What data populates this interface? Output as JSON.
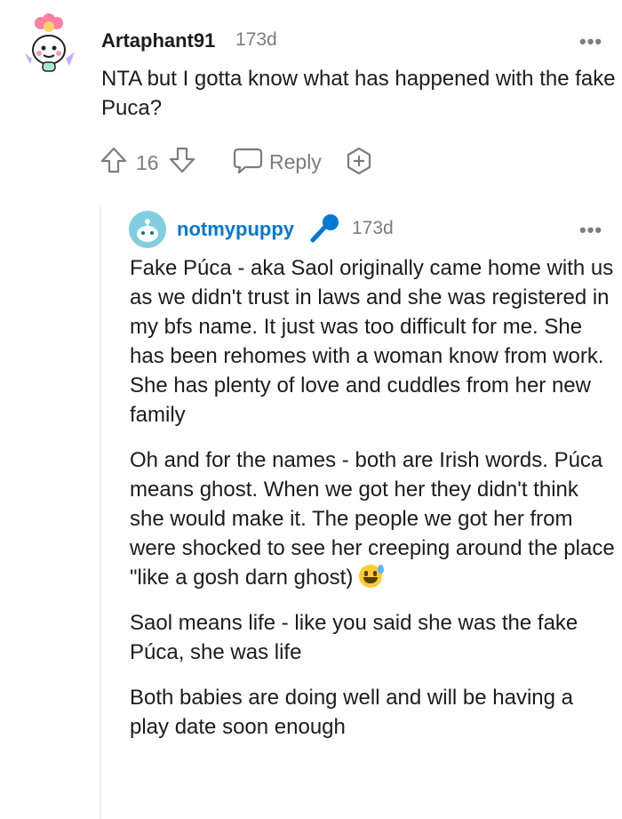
{
  "comment": {
    "username": "Artaphant91",
    "time": "173d",
    "more": "•••",
    "text": "NTA but I gotta know what has happened with the fake Puca?",
    "score": "16",
    "reply_label": "Reply"
  },
  "reply": {
    "username": "notmypuppy",
    "time": "173d",
    "more": "•••",
    "username_color": "#0079d3",
    "paragraphs": [
      "Fake Púca - aka Saol originally came home with us as we didn't trust in laws and she was registered in my bfs name. It just was too difficult for me. She has been rehomes with a woman know from work. She has plenty of love and cuddles from her new family",
      "Oh and for the names - both are Irish words. Púca means ghost. When we got her they didn't think she would make it. The people we got her from were shocked to see her creeping around the place \"like a gosh darn ghost)",
      "Saol means life - like you said she was the fake Púca, she was life",
      "Both babies are doing well and will be having a play date soon enough"
    ]
  },
  "icons": {
    "upvote": "upvote-arrow-icon",
    "downvote": "downvote-arrow-icon",
    "reply": "speech-bubble-icon",
    "award": "add-award-icon",
    "mic": "microphone-icon",
    "emoji": "sweat-smile-emoji-icon"
  }
}
